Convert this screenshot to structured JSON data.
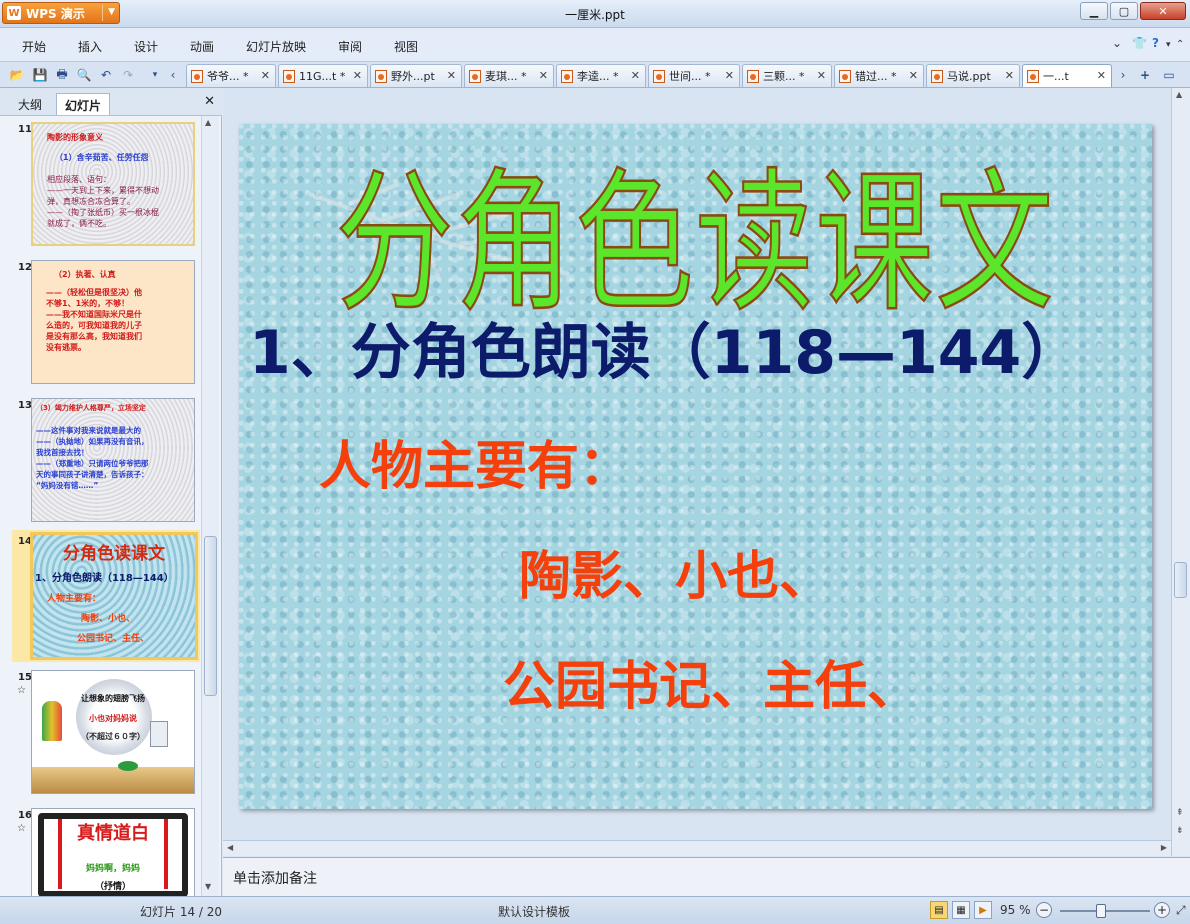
{
  "app": {
    "menu_label": "WPS 演示",
    "window_title": "一厘米.ppt"
  },
  "menu": {
    "items": [
      "开始",
      "插入",
      "设计",
      "动画",
      "幻灯片放映",
      "审阅",
      "视图"
    ]
  },
  "tabs": [
    {
      "label": "爷爷... *"
    },
    {
      "label": "11G...t *"
    },
    {
      "label": "野外...pt"
    },
    {
      "label": "麦琪... *"
    },
    {
      "label": "李逵... *"
    },
    {
      "label": "世间... *"
    },
    {
      "label": "三颗... *"
    },
    {
      "label": "错过... *"
    },
    {
      "label": "马说.ppt"
    },
    {
      "label": "一...t"
    }
  ],
  "left_panel": {
    "tab_outline": "大纲",
    "tab_slides": "幻灯片",
    "thumbnails": [
      {
        "num": "11",
        "lines": [
          "陶影的形象意义",
          "（1）含辛茹苦、任劳任怨",
          "相应段落、语句：",
          "——一天到上下来，累得不想动",
          "弹，真想冻合冻合算了。",
          "——（掏了张纸币）买一根冰棍",
          "就成了，俩不吃。"
        ]
      },
      {
        "num": "12",
        "lines": [
          "（2）执著、认真",
          "——（轻松但是很坚决）他",
          "不够1、1米的，不够！",
          "——我不知道国际米尺是什",
          "么造的，可我知道我的儿子",
          "是没有那么高，我知道我们",
          "没有逃票。"
        ]
      },
      {
        "num": "13",
        "lines": [
          "（3）竭力维护人格尊严，立场坚定",
          "——这件事对我来说就是最大的",
          "——（执拗地）如果再没有音讯，",
          "我找首接去找！",
          "——（郑重地）只请两位爷爷把那",
          "天的事同孩子讲清楚，告诉孩子：",
          "“妈妈没有错……”"
        ]
      },
      {
        "num": "14",
        "title": "分角色读课文",
        "heading": "1、分角色朗读（118—144）",
        "lines": [
          "人物主要有：",
          "陶影、小也、",
          "公园书记、主任、"
        ]
      },
      {
        "num": "15",
        "star": "☆",
        "lines": [
          "让想象的翅膀飞扬",
          "小也对妈妈说",
          "（不超过６０字）"
        ]
      },
      {
        "num": "16",
        "star": "☆",
        "lines": [
          "真情道白",
          "妈妈啊，妈妈",
          "（抒情）"
        ]
      }
    ]
  },
  "slide": {
    "title": "分角色读课文",
    "heading": "1、分角色朗读（118—144）",
    "subheading": "人物主要有：",
    "line1": "陶影、小也、",
    "line2": "公园书记、主任、"
  },
  "notes": {
    "placeholder": "单击添加备注"
  },
  "status": {
    "slide_info": "幻灯片 14 / 20",
    "template": "默认设计模板",
    "zoom": "95 %"
  }
}
